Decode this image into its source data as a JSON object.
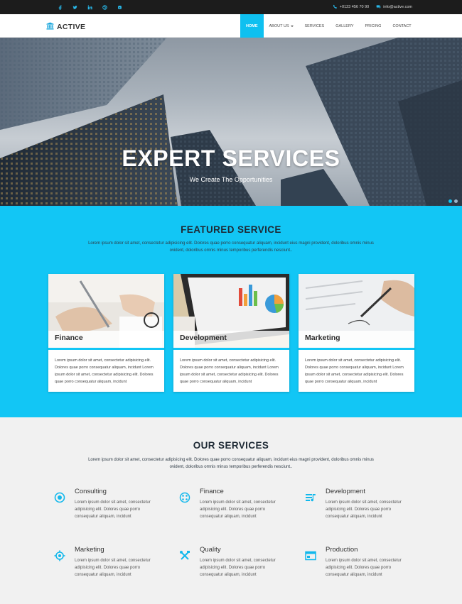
{
  "topbar": {
    "social_icons": [
      "facebook-icon",
      "twitter-icon",
      "linkedin-icon",
      "dribbble-icon",
      "skype-icon"
    ],
    "phone": "+0123 456 70 90",
    "email": "info@active.com"
  },
  "navbar": {
    "logo_text": "ACTIVE",
    "menu": [
      {
        "label": "HOME",
        "active": true
      },
      {
        "label": "ABOUT US",
        "dropdown": true
      },
      {
        "label": "SERVICES"
      },
      {
        "label": "GALLERY"
      },
      {
        "label": "PRICING"
      },
      {
        "label": "CONTACT"
      }
    ]
  },
  "hero": {
    "title": "EXPERT SERVICES",
    "subtitle": "We Create The Opportunities",
    "slides": 2,
    "active_slide": 1
  },
  "featured": {
    "title": "FEATURED SERVICE",
    "description": "Lorem ipsum dolor sit amet, consectetur adipisicing elit. Dolores quae porro consequatur aliquam, incidunt eius magni provident, doloribus omnis minus ovident, doloribus omnis minus temporibus perferendis nesciunt..",
    "cards": [
      {
        "label": "Finance",
        "text": "Lorem ipsum dolor sit amet, consectetur adipisicing elit. Dolores quae porro consequatur aliquam, incidunt Lorem ipsum dolor sit amet, consectetur adipisicing elit. Dolores quae porro consequatur aliquam, incidunt"
      },
      {
        "label": "Development",
        "text": "Lorem ipsum dolor sit amet, consectetur adipisicing elit. Dolores quae porro consequatur aliquam, incidunt Lorem ipsum dolor sit amet, consectetur adipisicing elit. Dolores quae porro consequatur aliquam, incidunt"
      },
      {
        "label": "Marketing",
        "text": "Lorem ipsum dolor sit amet, consectetur adipisicing elit. Dolores quae porro consequatur aliquam, incidunt Lorem ipsum dolor sit amet, consectetur adipisicing elit. Dolores quae porro consequatur aliquam, incidunt"
      }
    ]
  },
  "our_services": {
    "title": "OUR SERVICES",
    "description": "Lorem ipsum dolor sit amet, consectetur adipisicing elit. Dolores quae porro consequatur aliquam, incidunt eius magni provident, doloribus omnis minus ovident, doloribus omnis minus temporibus perferendis nesciunt..",
    "items": [
      {
        "name": "Consulting",
        "icon": "target-icon",
        "text": "Lorem ipsum dolor sit amet, consectetur adipisicing elit. Dolores quae porro consequatur aliquam, incidunt"
      },
      {
        "name": "Finance",
        "icon": "ornament-icon",
        "text": "Lorem ipsum dolor sit amet, consectetur adipisicing elit. Dolores quae porro consequatur aliquam, incidunt"
      },
      {
        "name": "Development",
        "icon": "list-icon",
        "text": "Lorem ipsum dolor sit amet, consectetur adipisicing elit. Dolores quae porro consequatur aliquam, incidunt"
      },
      {
        "name": "Marketing",
        "icon": "crosshair-icon",
        "text": "Lorem ipsum dolor sit amet, consectetur adipisicing elit. Dolores quae porro consequatur aliquam, incidunt"
      },
      {
        "name": "Quality",
        "icon": "tools-icon",
        "text": "Lorem ipsum dolor sit amet, consectetur adipisicing elit. Dolores quae porro consequatur aliquam, incidunt"
      },
      {
        "name": "Production",
        "icon": "window-icon",
        "text": "Lorem ipsum dolor sit amet, consectetur adipisicing elit. Dolores quae porro consequatur aliquam, incidunt"
      }
    ]
  },
  "colors": {
    "accent": "#12c6f5",
    "topbar": "#1c1c1c",
    "title": "#1e2a35"
  }
}
